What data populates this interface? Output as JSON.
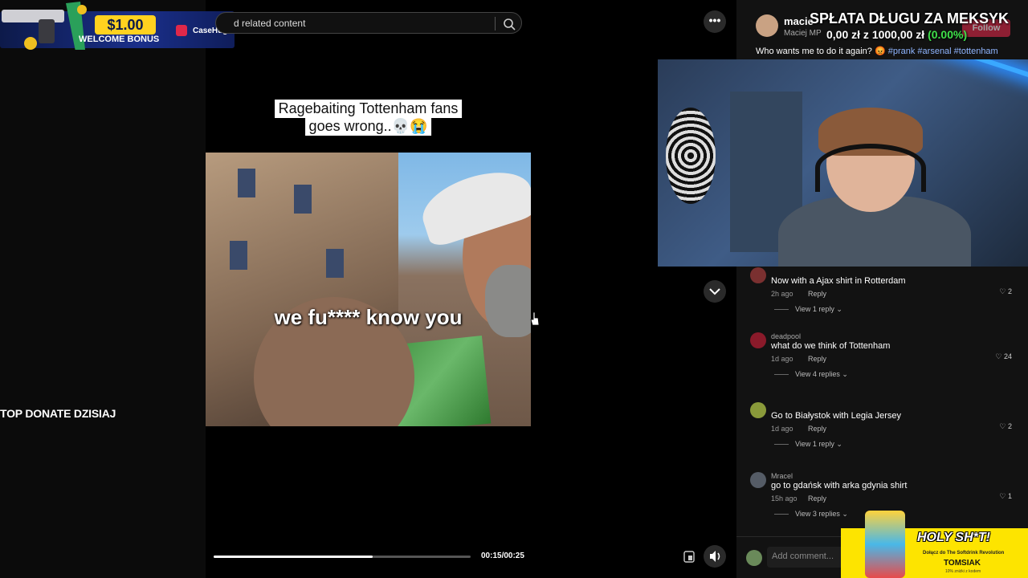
{
  "bonus": {
    "amount": "$1.00",
    "label": "WELCOME BONUS",
    "brand": "CaseHug"
  },
  "sidebar": {
    "top_donate": "TOP DONATE DZISIAJ"
  },
  "search": {
    "text": "d related content"
  },
  "video": {
    "caption_line1": "Ragebaiting Tottenham fans",
    "caption_line2": "goes wrong..💀😭",
    "subtitle": "we fu**** know you",
    "time": "00:15/00:25",
    "progress": 0.62
  },
  "header": {
    "more": "•••",
    "author_name": "macie",
    "author_sub": "Maciej MP",
    "follow": "Follow",
    "overlay_title": "SPŁATA DŁUGU ZA MEKSYK",
    "overlay_money_from": "0,00 zł",
    "overlay_money_mid": "z",
    "overlay_money_to": "1000,00 zł",
    "overlay_pct": "(0.00%)",
    "description": "Who wants me to do it again? 😡",
    "tags": "#prank #arsenal #tottenham"
  },
  "comments": [
    {
      "user": "",
      "text": "Now with a Ajax shirt in Rotterdam",
      "time": "2h ago",
      "reply": "Reply",
      "likes": "2",
      "view": "View 1 reply ⌄"
    },
    {
      "user": "deadpool",
      "text": "what do we think of Tottenham",
      "time": "1d ago",
      "reply": "Reply",
      "likes": "24",
      "view": "View 4 replies ⌄"
    },
    {
      "user": "",
      "text": "Go to Białystok with Legia Jersey",
      "time": "1d ago",
      "reply": "Reply",
      "likes": "2",
      "view": "View 1 reply ⌄"
    },
    {
      "user": "Mracel",
      "text": "go to gdańsk with arka gdynia shirt",
      "time": "15h ago",
      "reply": "Reply",
      "likes": "1",
      "view": "View 3 replies ⌄"
    }
  ],
  "add_comment": {
    "placeholder": "Add comment..."
  },
  "ad": {
    "headline": "HOLY SH*T!",
    "sub": "Dołącz do The Softdrink Revolution",
    "brand": "TOMSIAK",
    "tag": "10% zniżki z kodem"
  }
}
